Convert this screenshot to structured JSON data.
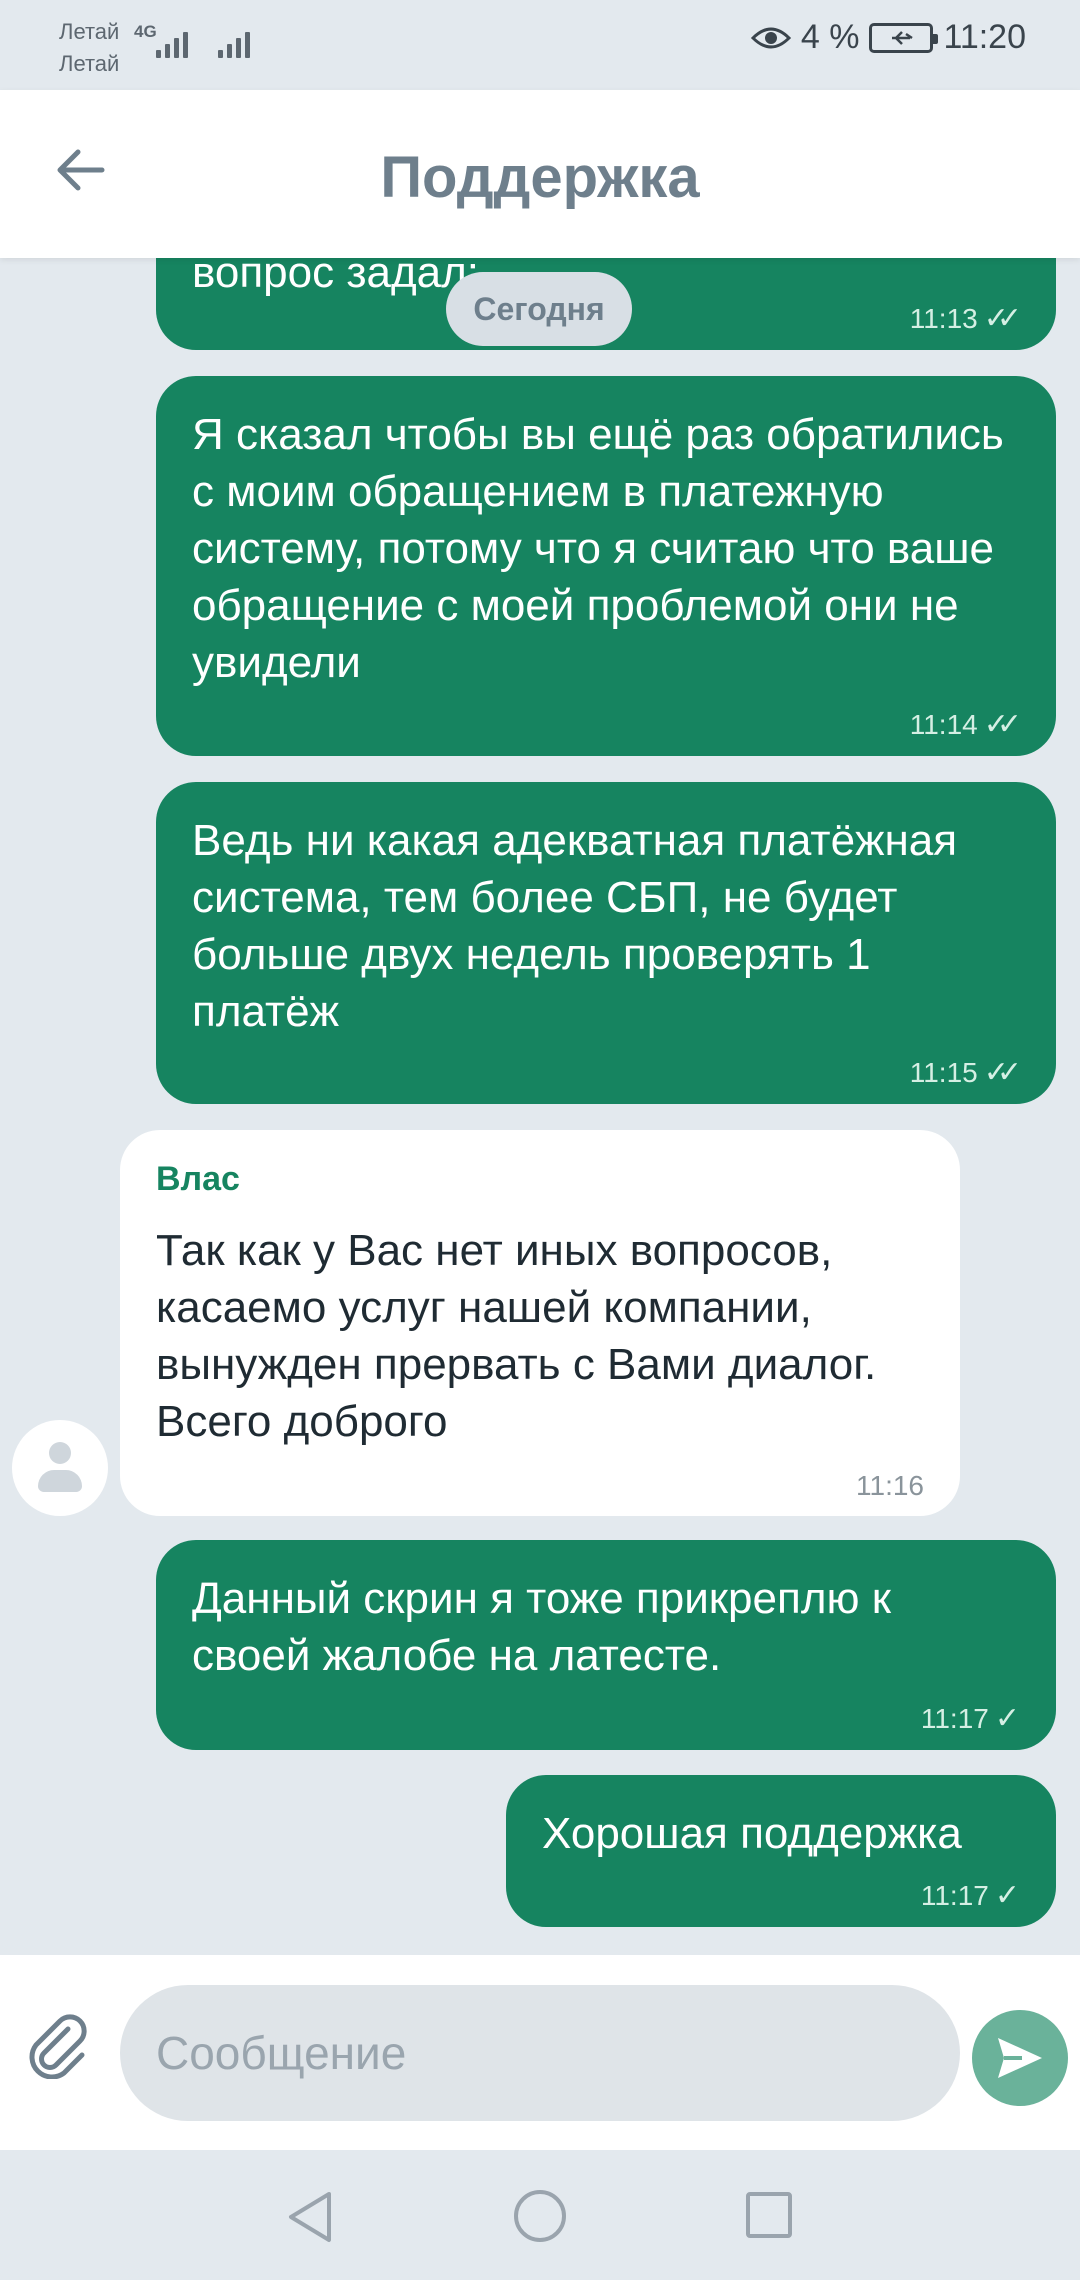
{
  "status_bar": {
    "carrier1": "Летай",
    "carrier2": "Летай",
    "network": "4G",
    "battery": "4 %",
    "time": "11:20"
  },
  "header": {
    "title": "Поддержка",
    "back_icon": "arrow-left-icon"
  },
  "chat": {
    "date_separator": "Сегодня",
    "partial_message": {
      "text": "вопрос задал:",
      "time": "11:13",
      "status": "read"
    },
    "messages": [
      {
        "direction": "out",
        "text": "Я сказал чтобы вы ещё раз обратились с моим обращением в платежную систему, потому что я считаю что ваше обращение с моей проблемой они не увидели",
        "time": "11:14",
        "status": "read"
      },
      {
        "direction": "out",
        "text": "Ведь ни какая адекватная платёжная система, тем более СБП, не будет больше двух недель проверять 1 платёж",
        "time": "11:15",
        "status": "read"
      },
      {
        "direction": "in",
        "sender": "Влас",
        "text": "Так как у Вас нет иных вопросов, касаемо услуг нашей компании, вынужден прервать с Вами диалог. Всего доброго",
        "time": "11:16"
      },
      {
        "direction": "out",
        "text": "Данный скрин я тоже прикреплю к своей жалобе на латесте.",
        "time": "11:17",
        "status": "sent"
      },
      {
        "direction": "out",
        "text": "Хорошая поддержка",
        "time": "11:17",
        "status": "sent"
      }
    ],
    "check_double": "✓✓",
    "check_single": "✓"
  },
  "input": {
    "placeholder": "Сообщение",
    "value": ""
  },
  "colors": {
    "outgoing_bubble": "#168460",
    "incoming_bubble": "#ffffff",
    "background": "#e3e9ee",
    "accent": "#168460"
  }
}
